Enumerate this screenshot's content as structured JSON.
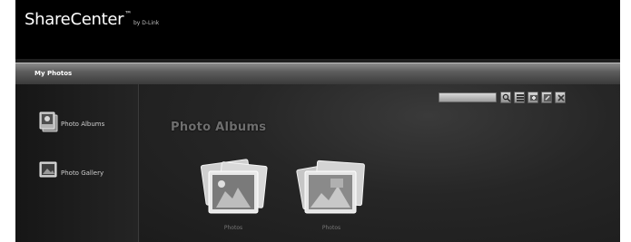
{
  "header": {
    "brand": "ShareCenter",
    "brand_mark": "™",
    "brand_sub": "by D-Link"
  },
  "tabbar": {
    "title": "My Photos"
  },
  "sidebar": {
    "items": [
      {
        "label": "Photo Albums",
        "icon": "photo-albums-icon"
      },
      {
        "label": "Photo Gallery",
        "icon": "photo-gallery-icon"
      }
    ]
  },
  "main": {
    "section_title": "Photo Albums",
    "search": {
      "placeholder": "",
      "value": ""
    },
    "toolbar": [
      {
        "icon": "search-icon"
      },
      {
        "icon": "list-view-icon"
      },
      {
        "icon": "add-album-icon"
      },
      {
        "icon": "edit-icon"
      },
      {
        "icon": "delete-icon"
      }
    ],
    "albums": [
      {
        "caption": "Photos"
      },
      {
        "caption": "Photos"
      }
    ]
  },
  "colors": {
    "header_bg": "#000000",
    "tabbar_bg": "#5d5d5d",
    "content_bg": "#262626",
    "text_light": "#ffffff"
  }
}
